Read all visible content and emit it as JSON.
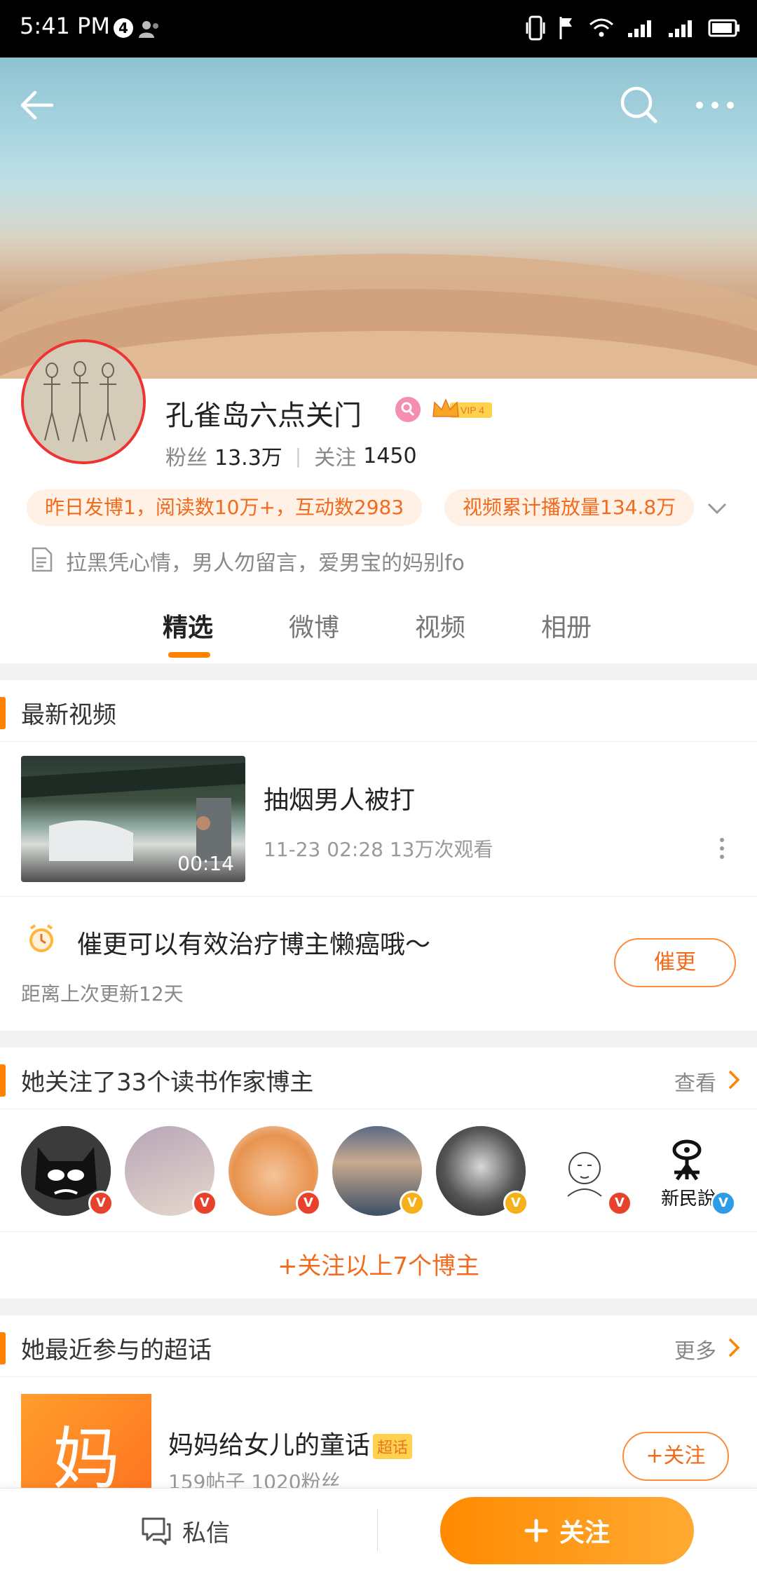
{
  "status_bar": {
    "time": "5:41 PM",
    "notification_count": "4"
  },
  "header": {
    "back_icon": "arrow-left-icon",
    "search_icon": "search-icon",
    "more_icon": "more-horizontal-icon"
  },
  "profile": {
    "nickname": "孔雀岛六点关门",
    "gender_icon": "female-icon",
    "vip_label": "VIP 4",
    "fans_label": "粉丝",
    "fans_value": "13.3万",
    "following_label": "关注",
    "following_value": "1450",
    "stat_pill_1": "昨日发博1，阅读数10万+，互动数2983",
    "stat_pill_2": "视频累计播放量134.8万",
    "bio": "拉黑凭心情，男人勿留言，爱男宝的妈别fo"
  },
  "tabs": [
    {
      "label": "精选",
      "active": true
    },
    {
      "label": "微博",
      "active": false
    },
    {
      "label": "视频",
      "active": false
    },
    {
      "label": "相册",
      "active": false
    }
  ],
  "latest_videos": {
    "section_title": "最新视频",
    "video": {
      "duration": "00:14",
      "title": "抽烟男人被打",
      "meta": "11-23 02:28 13万次观看"
    }
  },
  "urge": {
    "text": "催更可以有效治疗博主懒癌哦～",
    "sub": "距离上次更新12天",
    "button": "催更"
  },
  "following_section": {
    "title": "她关注了33个读书作家博主",
    "link": "查看",
    "avatars": [
      {
        "name": "batman-avatar",
        "badge": "V",
        "badge_color": "#e8412c"
      },
      {
        "name": "book-avatar",
        "badge": "V",
        "badge_color": "#e8412c"
      },
      {
        "name": "cat-avatar",
        "badge": "V",
        "badge_color": "#e8412c"
      },
      {
        "name": "woman-reading-avatar",
        "badge": "V",
        "badge_color": "#f5b01a"
      },
      {
        "name": "portrait-avatar",
        "badge": "V",
        "badge_color": "#f5b01a"
      },
      {
        "name": "sketch-avatar",
        "badge": "V",
        "badge_color": "#e8412c"
      },
      {
        "name": "xinminshuo-avatar",
        "badge": "V",
        "badge_color": "#2d9be8",
        "text": "新民說"
      }
    ],
    "follow_all": "+关注以上7个博主"
  },
  "super_topic_section": {
    "title": "她最近参与的超话",
    "link": "更多",
    "item": {
      "thumb_char": "妈",
      "title": "妈妈给女儿的童话",
      "tag": "超话",
      "meta": "159帖子 1020粉丝",
      "follow": "+关注"
    }
  },
  "bottom_bar": {
    "dm_label": "私信",
    "follow_label": "关注"
  },
  "colors": {
    "accent": "#ff8200",
    "accent_text": "#f26b1d",
    "pill_bg": "#fff1e6"
  }
}
